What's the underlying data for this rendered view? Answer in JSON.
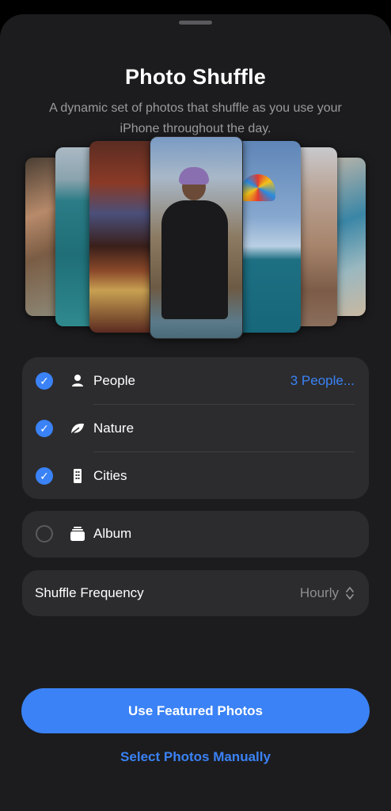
{
  "header": {
    "title": "Photo Shuffle",
    "subtitle": "A dynamic set of photos that shuffle as you use your iPhone throughout the day."
  },
  "categories": [
    {
      "label": "People",
      "icon": "person-icon",
      "checked": true,
      "value": "3 People..."
    },
    {
      "label": "Nature",
      "icon": "leaf-icon",
      "checked": true
    },
    {
      "label": "Cities",
      "icon": "building-icon",
      "checked": true
    }
  ],
  "album": {
    "label": "Album",
    "icon": "album-stack-icon",
    "checked": false
  },
  "frequency": {
    "label": "Shuffle Frequency",
    "value": "Hourly"
  },
  "actions": {
    "primary": "Use Featured Photos",
    "secondary": "Select Photos Manually"
  },
  "colors": {
    "accent": "#3a82f6",
    "sheet_bg": "#1c1c1e",
    "card_bg": "#2c2c2e",
    "secondary_text": "#8e8e93"
  }
}
